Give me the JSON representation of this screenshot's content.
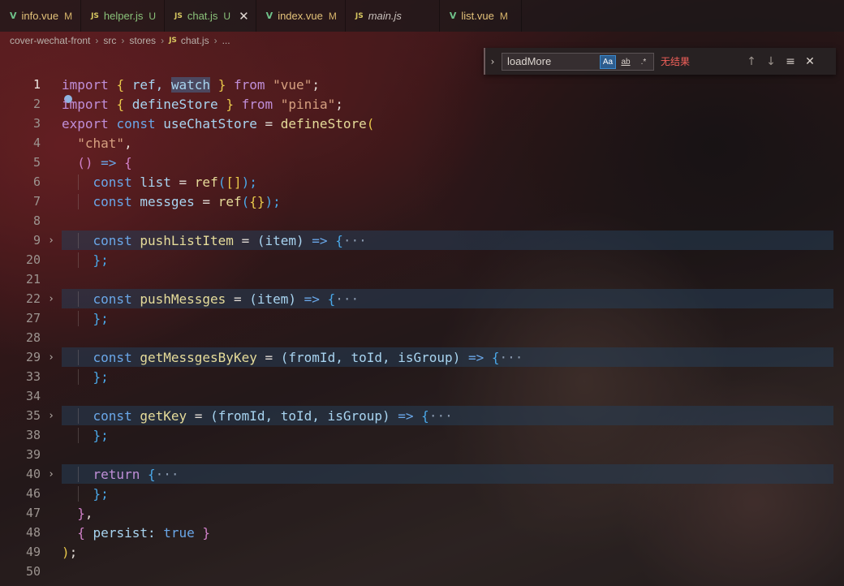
{
  "tabs": [
    {
      "icon": "V",
      "kind": "vue",
      "name": "info.vue",
      "status": "M",
      "style": "modified"
    },
    {
      "icon": "JS",
      "kind": "js",
      "name": "helper.js",
      "status": "U",
      "style": "untracked"
    },
    {
      "icon": "JS",
      "kind": "js",
      "name": "chat.js",
      "status": "U",
      "style": "untracked",
      "active": true
    },
    {
      "icon": "V",
      "kind": "vue",
      "name": "index.vue",
      "status": "M",
      "style": "modified"
    },
    {
      "icon": "JS",
      "kind": "js",
      "name": "main.js",
      "status": "",
      "style": "italic"
    },
    {
      "icon": "V",
      "kind": "vue",
      "name": "list.vue",
      "status": "M",
      "style": "modified"
    }
  ],
  "breadcrumb": {
    "project": "cover-wechat-front",
    "folder1": "src",
    "folder2": "stores",
    "file_icon": "JS",
    "file": "chat.js",
    "ellipsis": "..."
  },
  "find": {
    "toggle": "›",
    "query": "loadMore",
    "opt_case": "Aa",
    "opt_word": "ab",
    "opt_regex": ".*",
    "result": "无结果",
    "prev": "↑",
    "next": "↓",
    "selection": "≡",
    "close": "✕"
  },
  "editor": {
    "line_numbers": [
      "1",
      "2",
      "3",
      "4",
      "5",
      "6",
      "7",
      "8",
      "9",
      "20",
      "21",
      "22",
      "27",
      "28",
      "29",
      "33",
      "34",
      "35",
      "38",
      "39",
      "40",
      "46",
      "47",
      "48",
      "49",
      "50"
    ],
    "fold_marker": "›",
    "ellipsis": "···",
    "tokens": {
      "l1": [
        "import",
        "{",
        "ref,",
        "watch",
        "}",
        "from",
        "\"vue\"",
        ";"
      ],
      "l2": [
        "import",
        "{",
        "defineStore",
        "}",
        "from",
        "\"pinia\"",
        ";"
      ],
      "l3": [
        "export",
        "const",
        "useChatStore",
        "=",
        "defineStore",
        "("
      ],
      "l4": [
        "\"chat\"",
        ","
      ],
      "l5": [
        "()",
        "=>",
        "{"
      ],
      "l6": [
        "const",
        "list",
        "=",
        "ref",
        "(",
        "[]",
        ");"
      ],
      "l7": [
        "const",
        "messges",
        "=",
        "ref",
        "(",
        "{}",
        ");"
      ],
      "l9": [
        "const",
        "pushListItem",
        "=",
        "(item)",
        "=>",
        "{"
      ],
      "l20": [
        "};"
      ],
      "l22": [
        "const",
        "pushMessges",
        "=",
        "(item)",
        "=>",
        "{"
      ],
      "l27": [
        "};"
      ],
      "l29": [
        "const",
        "getMessgesByKey",
        "=",
        "(fromId, toId, isGroup)",
        "=>",
        "{"
      ],
      "l33": [
        "};"
      ],
      "l35": [
        "const",
        "getKey",
        "=",
        "(fromId, toId, isGroup)",
        "=>",
        "{"
      ],
      "l38": [
        "};"
      ],
      "l40": [
        "return",
        "{"
      ],
      "l46": [
        "};"
      ],
      "l47": [
        "}",
        ","
      ],
      "l48": [
        "{",
        "persist:",
        "true",
        "}"
      ],
      "l49": [
        ")",
        ";"
      ]
    }
  }
}
